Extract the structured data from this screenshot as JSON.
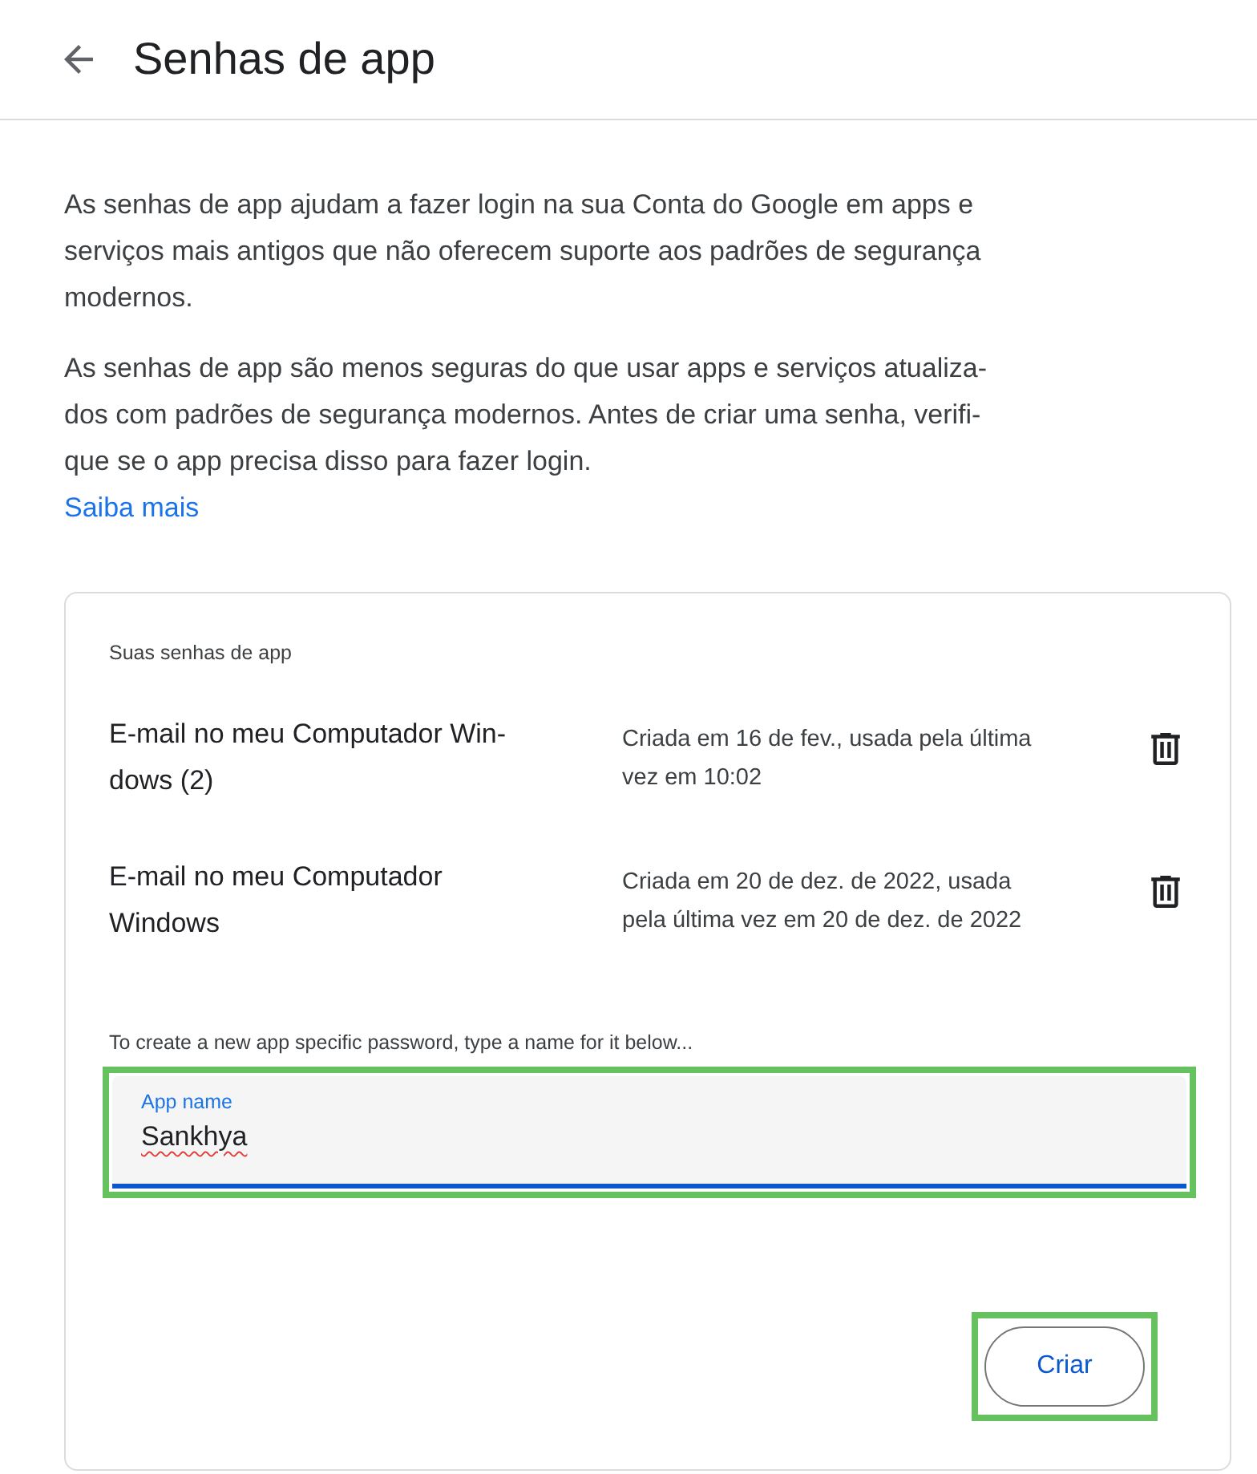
{
  "header": {
    "title": "Senhas de app"
  },
  "intro": {
    "paragraphs": [
      {
        "lines": [
          "As senhas de app ajudam a fazer login na sua Conta do Google em apps e",
          "serviços mais antigos que não oferecem suporte aos padrões de segurança",
          "modernos."
        ]
      },
      {
        "lines": [
          "As senhas de app são menos seguras do que usar apps e serviços atualiza-",
          "dos com padrões de segurança modernos. Antes de criar uma senha, verifi-",
          "que se o app precisa disso para fazer login."
        ]
      }
    ],
    "link": "Saiba mais"
  },
  "card": {
    "heading": "Suas senhas de app",
    "passwords": [
      {
        "name_lines": [
          "E-mail no meu Computador Win-",
          "dows (2)"
        ],
        "detail_lines": [
          "Criada em 16 de fev., usada pela última",
          "vez em 10:02"
        ]
      },
      {
        "name_lines": [
          "E-mail no meu Computador",
          "Windows"
        ],
        "detail_lines": [
          "Criada em 20 de dez. de 2022, usada",
          "pela última vez em 20 de dez. de 2022"
        ]
      }
    ],
    "instruction": "To create a new app specific password, type a name for it below...",
    "field": {
      "label": "App name",
      "value": "Sankhya",
      "focused": true,
      "spellcheck_error": true,
      "highlighted": true
    },
    "button": {
      "label": "Criar",
      "highlighted": true
    }
  }
}
